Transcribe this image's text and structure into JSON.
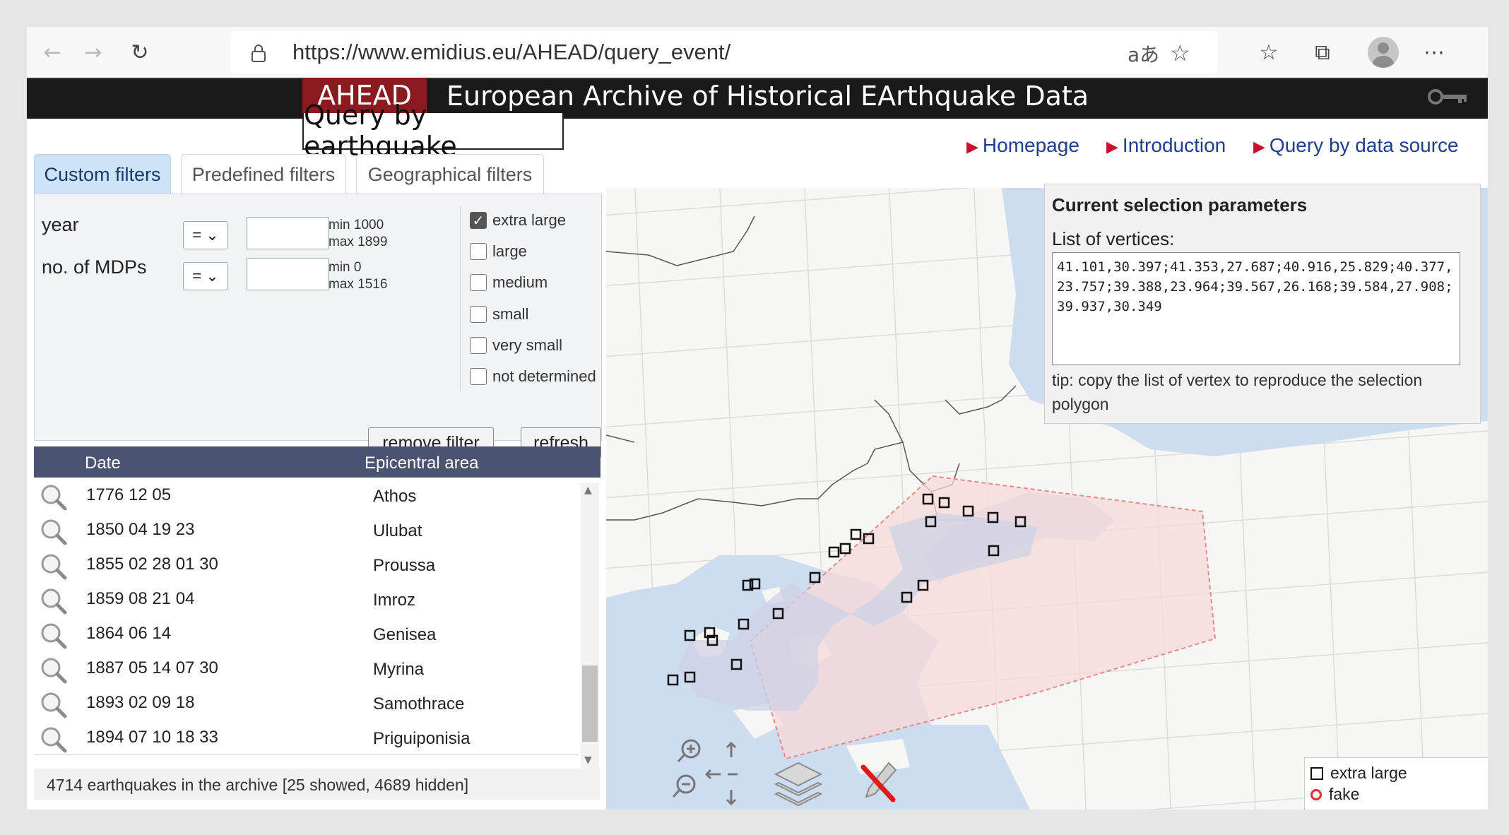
{
  "browser": {
    "url": "https://www.emidius.eu/AHEAD/query_event/",
    "read_aloud_glyph": "aあ"
  },
  "site": {
    "badge": "AHEAD",
    "title": "European Archive of Historical EArthquake Data",
    "page_title": "Query by earthquake"
  },
  "top_links": [
    {
      "label": "Homepage"
    },
    {
      "label": "Introduction"
    },
    {
      "label": "Query by data source"
    }
  ],
  "tabs": [
    {
      "label": "Custom filters",
      "active": true
    },
    {
      "label": "Predefined filters",
      "active": false
    },
    {
      "label": "Geographical filters",
      "active": false
    }
  ],
  "filters": {
    "year": {
      "label": "year",
      "operator": "=",
      "value": "",
      "min": "min 1000",
      "max": "max 1899"
    },
    "mdps": {
      "label": "no. of MDPs",
      "operator": "=",
      "value": "",
      "min": "min 0",
      "max": "max 1516"
    },
    "size_classes": [
      {
        "label": "extra large",
        "checked": true
      },
      {
        "label": "large",
        "checked": false
      },
      {
        "label": "medium",
        "checked": false
      },
      {
        "label": "small",
        "checked": false
      },
      {
        "label": "very small",
        "checked": false
      },
      {
        "label": "not determined",
        "checked": false
      }
    ],
    "remove_label": "remove filter",
    "refresh_label": "refresh"
  },
  "table": {
    "columns": [
      "Date",
      "Epicentral area"
    ],
    "rows": [
      {
        "date": "1776 12 05",
        "area": "Athos"
      },
      {
        "date": "1850 04 19 23",
        "area": "Ulubat"
      },
      {
        "date": "1855 02 28 01 30",
        "area": "Proussa"
      },
      {
        "date": "1859 08 21 04",
        "area": "Imroz"
      },
      {
        "date": "1864 06 14",
        "area": "Genisea"
      },
      {
        "date": "1887 05 14 07 30",
        "area": "Myrina"
      },
      {
        "date": "1893 02 09 18",
        "area": "Samothrace"
      },
      {
        "date": "1894 07 10 18 33",
        "area": "Priguiponisia"
      }
    ],
    "footer": "4714 earthquakes in the archive [25 showed, 4689 hidden]"
  },
  "selection": {
    "title": "Current selection parameters",
    "vertices_label": "List of vertices:",
    "vertices": "41.101,30.397;41.353,27.687;40.916,25.829;40.377,23.757;39.388,23.964;39.567,26.168;39.584,27.908;39.937,30.349",
    "tip": "tip: copy the list of vertex to reproduce the selection polygon"
  },
  "legend": {
    "items": [
      {
        "label": "extra large",
        "symbol": "square",
        "color": "#111111"
      },
      {
        "label": "fake",
        "symbol": "circle",
        "color": "#e03030"
      }
    ]
  },
  "colors": {
    "brand": "#8b1a1e",
    "header_bg": "#1a1a1a",
    "table_header": "#4a5470",
    "link": "#1f3e8c",
    "link_arrow": "#c8102e",
    "active_tab": "#cfe3f7",
    "sea": "#cddcef",
    "selection_fill": "#f5d9d9"
  }
}
